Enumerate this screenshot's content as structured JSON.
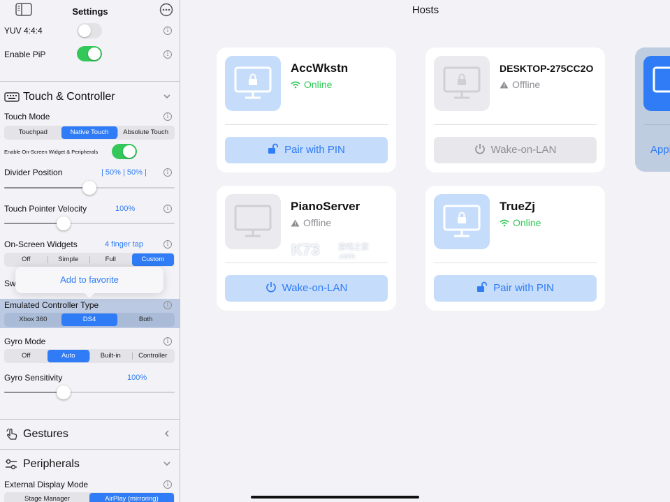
{
  "sidebar": {
    "title": "Settings",
    "yuv": {
      "label": "YUV 4:4:4",
      "on": false
    },
    "pip": {
      "label": "Enable PiP",
      "on": true
    },
    "touch_section": {
      "label": "Touch & Controller"
    },
    "touch_mode": {
      "label": "Touch Mode",
      "options": [
        "Touchpad",
        "Native Touch",
        "Absolute Touch"
      ],
      "selected": "Native Touch"
    },
    "onscreen_widget_peripherals": {
      "label": "Enable On-Screen Widget & Peripherals",
      "on": true
    },
    "divider_position": {
      "label": "Divider Position",
      "value": "| 50% | 50% |",
      "level": 0.5
    },
    "touch_pointer_velocity": {
      "label": "Touch Pointer Velocity",
      "value": "100%",
      "level": 0.35
    },
    "onscreen_widgets": {
      "label": "On-Screen Widgets",
      "value": "4 finger tap",
      "options": [
        "Off",
        "Simple",
        "Full",
        "Custom"
      ],
      "selected": "Custom"
    },
    "swap_row_partial": "Sw",
    "popover": {
      "label": "Add to favorite"
    },
    "emulated_controller": {
      "label": "Emulated Controller Type",
      "options": [
        "Xbox 360",
        "DS4",
        "Both"
      ],
      "selected": "DS4"
    },
    "gyro_mode": {
      "label": "Gyro Mode",
      "options": [
        "Off",
        "Auto",
        "Built-in",
        "Controller"
      ],
      "selected": "Auto"
    },
    "gyro_sensitivity": {
      "label": "Gyro Sensitivity",
      "value": "100%",
      "level": 0.35
    },
    "gestures_section": {
      "label": "Gestures"
    },
    "peripherals_section": {
      "label": "Peripherals"
    },
    "external_display": {
      "label": "External Display Mode",
      "options": [
        "Stage Manager",
        "AirPlay (mirroring)"
      ],
      "selected": "AirPlay (mirroring)"
    }
  },
  "main": {
    "title": "Hosts",
    "hosts": [
      {
        "name": "AccWkstn",
        "status": "Online",
        "action": "Pair with PIN"
      },
      {
        "name": "DESKTOP-275CC2O",
        "status": "Offline",
        "action": "Wake-on-LAN"
      },
      {
        "name": "PianoServer",
        "status": "Offline",
        "action": "Wake-on-LAN"
      },
      {
        "name": "TrueZj",
        "status": "Online",
        "action": "Pair with PIN"
      }
    ],
    "peek_action": "Appl"
  },
  "watermark": {
    "text": "K73",
    "sub": "游戏之家",
    "domain": ".com"
  },
  "colors": {
    "accent": "#2f7cf6",
    "online": "#34c759",
    "offline": "#8e8e93",
    "toggle_on": "#34c759",
    "card_bg": "#ffffff",
    "page_bg": "#f2f2f7"
  },
  "icons": {
    "sidebar_toggle": "sidebar-icon",
    "more": "ellipsis-circle-icon",
    "monitor": "display-lock-icon",
    "online": "wifi-icon",
    "offline": "warning-triangle-icon",
    "pair": "unlock-icon",
    "wake": "power-icon"
  }
}
